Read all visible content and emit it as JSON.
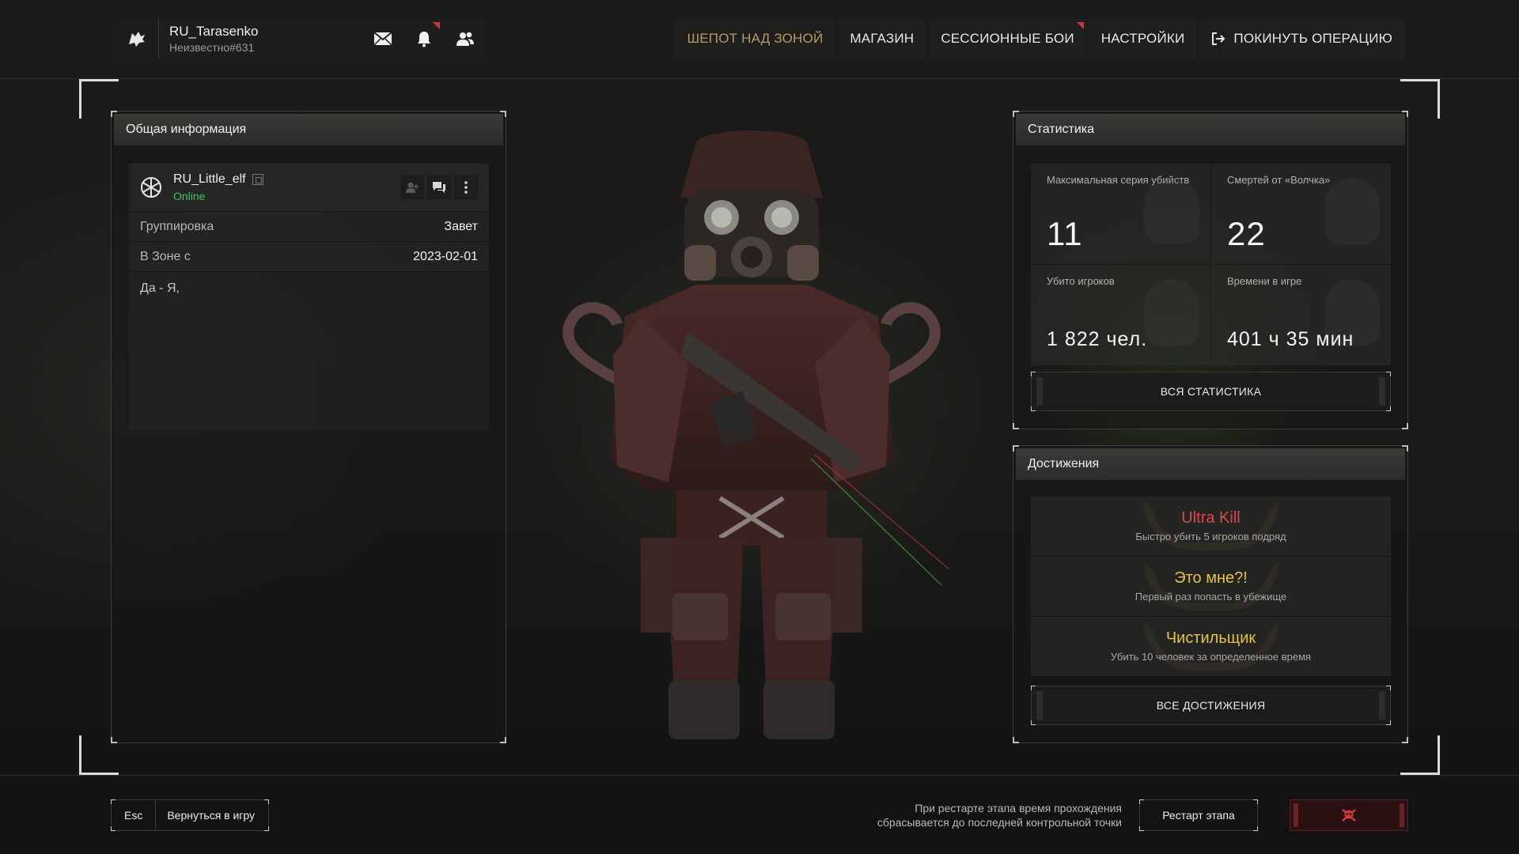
{
  "header": {
    "username": "RU_Tarasenko",
    "user_tag": "Неизвестно#631",
    "icons": [
      "mail-icon",
      "bell-icon",
      "friends-icon"
    ],
    "nav": [
      {
        "label": "ШЕПОТ НАД ЗОНОЙ",
        "active": true
      },
      {
        "label": "МАГАЗИН"
      },
      {
        "label": "СЕССИОННЫЕ БОИ",
        "badge": true
      },
      {
        "label": "НАСТРОЙКИ"
      },
      {
        "label": "ПОКИНУТЬ ОПЕРАЦИЮ",
        "icon": "exit-icon"
      }
    ]
  },
  "info": {
    "title": "Общая информация",
    "player_name": "RU_Little_elf",
    "status": "Online",
    "rows": [
      {
        "key": "Группировка",
        "value": "Завет"
      },
      {
        "key": "В Зоне с",
        "value": "2023-02-01"
      }
    ],
    "bio": "Да - Я,"
  },
  "stats": {
    "title": "Статистика",
    "cells": [
      {
        "label": "Максимальная серия убийств",
        "value": "11"
      },
      {
        "label": "Смертей от «Волчка»",
        "value": "22"
      },
      {
        "label": "Убито игроков",
        "value": "1 822 чел."
      },
      {
        "label": "Времени в игре",
        "value": "401 ч 35 мин"
      }
    ],
    "button": "ВСЯ СТАТИСТИКА"
  },
  "achievements": {
    "title": "Достижения",
    "items": [
      {
        "title": "Ultra Kill",
        "desc": "Быстро убить 5 игроков подряд",
        "color": "#e0464a"
      },
      {
        "title": "Это мне?!",
        "desc": "Первый раз попасть в убежище",
        "color": "#e6c04a"
      },
      {
        "title": "Чистильщик",
        "desc": "Убить 10 человек за определенное время",
        "color": "#e6c04a"
      }
    ],
    "button": "ВСЕ ДОСТИЖЕНИЯ"
  },
  "footer": {
    "esc_key": "Esc",
    "back_label": "Вернуться в игру",
    "restart_note_line1": "При рестарте этапа время прохождения",
    "restart_note_line2": "сбрасывается до последней контрольной точки",
    "restart_button": "Рестарт этапа",
    "skull_icon": "skull-crossbones-icon"
  },
  "colors": {
    "accent_gold": "#b59a6a",
    "online_green": "#3fc25a",
    "danger_red": "#d0363d"
  }
}
